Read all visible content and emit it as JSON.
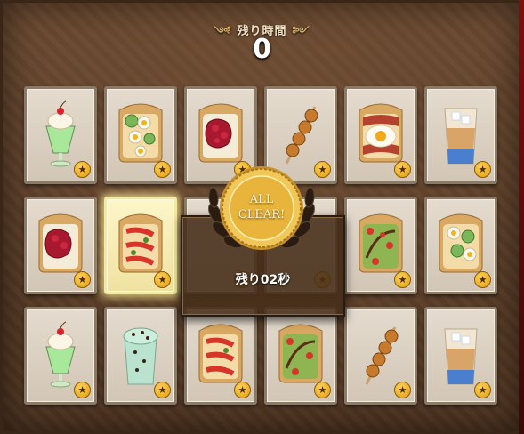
{
  "timer": {
    "label": "残り時間",
    "left_flourish": "༺",
    "right_flourish": "༻",
    "value": "0"
  },
  "overlay": {
    "medal_line1": "ALL",
    "medal_line2": "CLEAR!",
    "remaining_text": "残り02秒"
  },
  "cards": [
    {
      "food": "cream-soda-icon",
      "star": "★"
    },
    {
      "food": "egg-cucumber-toast-icon",
      "star": "★"
    },
    {
      "food": "jam-toast-icon",
      "star": "★"
    },
    {
      "food": "dango-icon",
      "star": "★"
    },
    {
      "food": "bacon-egg-toast-icon",
      "star": "★"
    },
    {
      "food": "iced-drink-icon",
      "star": "★"
    },
    {
      "food": "jam-toast-icon",
      "star": "★"
    },
    {
      "food": "tomato-toast-icon",
      "star": "★"
    },
    {
      "food": "hidden-card",
      "star": "★"
    },
    {
      "food": "hidden-card",
      "star": "★"
    },
    {
      "food": "avocado-toast-icon",
      "star": "★"
    },
    {
      "food": "egg-cucumber-toast-icon",
      "star": "★"
    },
    {
      "food": "cream-soda-icon",
      "star": "★"
    },
    {
      "food": "mint-chip-drink-icon",
      "star": "★"
    },
    {
      "food": "tomato-toast-icon",
      "star": "★"
    },
    {
      "food": "avocado-toast-icon",
      "star": "★"
    },
    {
      "food": "dango-icon",
      "star": "★"
    },
    {
      "food": "iced-drink-icon",
      "star": "★"
    }
  ]
}
